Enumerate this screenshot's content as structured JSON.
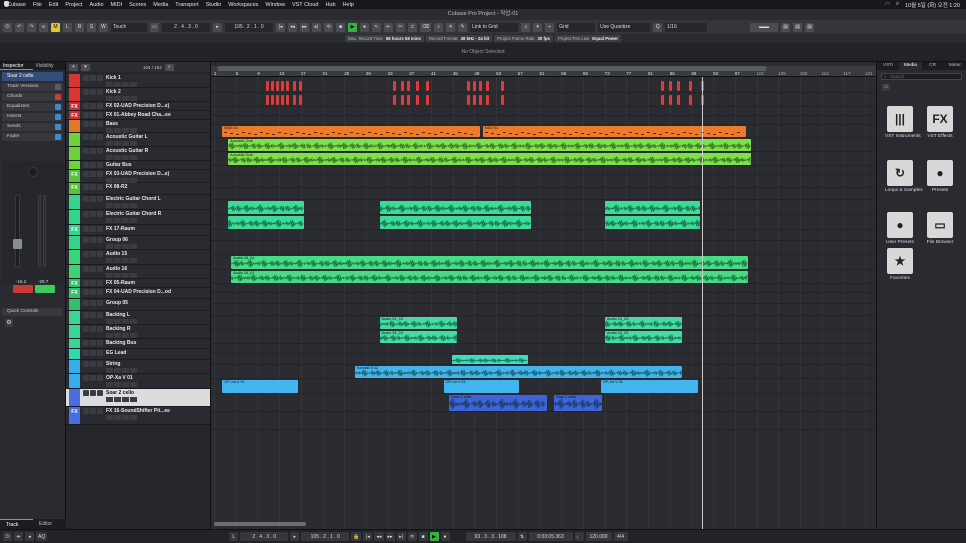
{
  "menubar": {
    "app": "Cubase",
    "items": [
      "File",
      "Edit",
      "Project",
      "Audio",
      "MIDI",
      "Scores",
      "Media",
      "Transport",
      "Studio",
      "Workspaces",
      "Window",
      "VST Cloud",
      "Hub",
      "Help"
    ],
    "clock": "10월 5일 (화) 오전 1:20"
  },
  "window": {
    "title": "Cubase Pro Project - 작업-01"
  },
  "toolbar": {
    "mode": "Touch",
    "left_position": "2 . 4 . 3 .   0",
    "right_position": "105 . 2 . 1 .   0",
    "snap_type": "Link to Grid",
    "grid": "Grid",
    "quantize_label": "Use Quantize",
    "quantize_value": "1/16",
    "letters": [
      "M",
      "L",
      "R",
      "S",
      "W"
    ]
  },
  "info_line": [
    {
      "k": "Max. Record Time",
      "v": "68 hours 58 mins"
    },
    {
      "k": "Record Format",
      "v": "48 kHz - 24 bit"
    },
    {
      "k": "Project Frame Rate",
      "v": "30 fps"
    },
    {
      "k": "Project Pan Law",
      "v": "Equal Power"
    }
  ],
  "status": "No Object Selected",
  "inspector": {
    "tabs": [
      "Inspector",
      "Visibility"
    ],
    "track_name": "Soar 2 cello",
    "sections": [
      "Track Versions",
      "Chords",
      "Equalizers",
      "Inserts",
      "Sends",
      "Fader"
    ],
    "fader_left": "-16.2",
    "fader_right": "-29.7",
    "quick": "Quick Controls",
    "bottom_tabs": [
      "Track",
      "Editor"
    ]
  },
  "tracklist": {
    "counter": "104 / 104"
  },
  "tracks": [
    {
      "name": "Kick 1",
      "color": "#d83535",
      "fx": false
    },
    {
      "name": "Kick 2",
      "color": "#d83535",
      "fx": false
    },
    {
      "name": "FX 02-UAD Precision D...e)",
      "color": "#c53030",
      "fx": true
    },
    {
      "name": "FX 01-Abbey Road Cha...ee",
      "color": "#c53030",
      "fx": true
    },
    {
      "name": "Bass",
      "color": "#e0792a",
      "fx": false
    },
    {
      "name": "Acoustic Guitar L",
      "color": "#6ad43a",
      "fx": false
    },
    {
      "name": "Acoustic Guitar R",
      "color": "#6ad43a",
      "fx": false
    },
    {
      "name": "Guitar Bus",
      "color": "#6ad43a",
      "fx": false
    },
    {
      "name": "FX 03-UAD Precision D...e)",
      "color": "#58c23a",
      "fx": true
    },
    {
      "name": "FX 08-R2",
      "color": "#58c23a",
      "fx": true
    },
    {
      "name": "Electric Guitar Chord L",
      "color": "#35d48a",
      "fx": false
    },
    {
      "name": "Electric Guitar Chord R",
      "color": "#35d48a",
      "fx": false
    },
    {
      "name": "FX 17-Raum",
      "color": "#35d48a",
      "fx": true
    },
    {
      "name": "Group 06",
      "color": "#35d48a",
      "fx": false
    },
    {
      "name": "Audio 15",
      "color": "#3ad475",
      "fx": false
    },
    {
      "name": "Audio 16",
      "color": "#3ad475",
      "fx": false
    },
    {
      "name": "FX 05-Raum",
      "color": "#32c06a",
      "fx": true
    },
    {
      "name": "FX 04-UAD Precision D...od",
      "color": "#32c06a",
      "fx": true
    },
    {
      "name": "Group 05",
      "color": "#32c06a",
      "fx": false
    },
    {
      "name": "Backing L",
      "color": "#3ad495",
      "fx": false
    },
    {
      "name": "Backing R",
      "color": "#3ad495",
      "fx": false
    },
    {
      "name": "Backing Bus",
      "color": "#3ad495",
      "fx": false
    },
    {
      "name": "EG Lead",
      "color": "#32d9b0",
      "fx": false
    },
    {
      "name": "String",
      "color": "#38aee8",
      "fx": false
    },
    {
      "name": "OP-Xa V 01",
      "color": "#38aee8",
      "fx": false
    },
    {
      "name": "Soar 2 cello",
      "color": "#4a6de0",
      "fx": false
    },
    {
      "name": "FX 16-SoundShifter Pit...ee",
      "color": "#4a6de0",
      "fx": true
    }
  ],
  "ruler": {
    "ticks": [
      "1",
      "5",
      "9",
      "13",
      "17",
      "21",
      "25",
      "29",
      "33",
      "37",
      "41",
      "45",
      "49",
      "53",
      "57",
      "61",
      "65",
      "69",
      "73",
      "77",
      "81",
      "85",
      "89",
      "93",
      "97",
      "101",
      "105",
      "109",
      "113",
      "117",
      "121"
    ]
  },
  "clips": [
    {
      "t": 4,
      "s": 3,
      "e": 180,
      "color": "#ee7b2c",
      "label": "MIDI 01"
    },
    {
      "t": 4,
      "s": 182,
      "e": 363,
      "color": "#ee7b2c",
      "label": "MIDI 01"
    },
    {
      "t": 5,
      "s": 7,
      "e": 366,
      "color": "#7ee04a",
      "label": "Acoustic Guit",
      "wave": true
    },
    {
      "t": 6,
      "s": 7,
      "e": 366,
      "color": "#7ee04a",
      "label": "Acoustic Guit",
      "wave": true
    },
    {
      "t": 10,
      "s": 7,
      "e": 59,
      "color": "#3cdc98",
      "label": "",
      "wave": true
    },
    {
      "t": 10,
      "s": 111,
      "e": 215,
      "color": "#3cdc98",
      "label": "",
      "wave": true
    },
    {
      "t": 10,
      "s": 266,
      "e": 331,
      "color": "#3cdc98",
      "label": "",
      "wave": true
    },
    {
      "t": 11,
      "s": 7,
      "e": 59,
      "color": "#3cdc98",
      "label": "",
      "wave": true
    },
    {
      "t": 11,
      "s": 111,
      "e": 215,
      "color": "#3cdc98",
      "label": "",
      "wave": true
    },
    {
      "t": 11,
      "s": 266,
      "e": 331,
      "color": "#3cdc98",
      "label": "",
      "wave": true
    },
    {
      "t": 14,
      "s": 9,
      "e": 364,
      "color": "#45dc85",
      "label": "Audio 15_01",
      "wave": true
    },
    {
      "t": 15,
      "s": 9,
      "e": 364,
      "color": "#45dc85",
      "label": "Audio 16_01",
      "wave": true
    },
    {
      "t": 19,
      "s": 111,
      "e": 164,
      "color": "#45dca4",
      "label": "Audio 24_03",
      "wave": true
    },
    {
      "t": 19,
      "s": 266,
      "e": 319,
      "color": "#45dca4",
      "label": "Audio 24_03",
      "wave": true
    },
    {
      "t": 20,
      "s": 111,
      "e": 164,
      "color": "#45dca4",
      "label": "Audio 24_03",
      "wave": true
    },
    {
      "t": 20,
      "s": 266,
      "e": 319,
      "color": "#45dca4",
      "label": "Audio 24_03",
      "wave": true
    },
    {
      "t": 22,
      "s": 161,
      "e": 213,
      "color": "#40dcbe",
      "label": "",
      "wave": true
    },
    {
      "t": 23,
      "s": 94,
      "e": 319,
      "color": "#42b5ef",
      "label": "Kontakt 6 02",
      "wave": true
    },
    {
      "t": 24,
      "s": 3,
      "e": 55,
      "color": "#42b5ef",
      "label": "OP-Xa V 01"
    },
    {
      "t": 24,
      "s": 155,
      "e": 207,
      "color": "#42b5ef",
      "label": "OP-Xa V 01"
    },
    {
      "t": 24,
      "s": 263,
      "e": 330,
      "color": "#42b5ef",
      "label": "OP-Xa V 01"
    },
    {
      "t": 25,
      "s": 159,
      "e": 226,
      "color": "#3f63db",
      "label": "Soar 2 cello",
      "wave": true
    },
    {
      "t": 25,
      "s": 231,
      "e": 264,
      "color": "#3f63db",
      "label": "Soar 2 cello",
      "wave": true
    }
  ],
  "mediabay": {
    "tabs": [
      "VSTi",
      "Media",
      "CR",
      "Meter"
    ],
    "search_placeholder": "Search",
    "tiles": [
      {
        "label": "VST Instruments",
        "icon": "|||"
      },
      {
        "label": "VST Effects",
        "icon": "FX"
      },
      {
        "label": "Loops & Samples",
        "icon": "↻"
      },
      {
        "label": "Presets",
        "icon": "●"
      },
      {
        "label": "User Presets",
        "icon": "●"
      },
      {
        "label": "File Browser",
        "icon": "▭"
      },
      {
        "label": "Favorites",
        "icon": "★"
      }
    ]
  },
  "transport": {
    "left": "2 . 4 . 3 .   0",
    "right": "105 . 2 . 1 .   0",
    "position": "93 . 3 . 3 . 108",
    "time": "0:03:05.363",
    "tempo": "120.000",
    "sig": "4/4"
  }
}
